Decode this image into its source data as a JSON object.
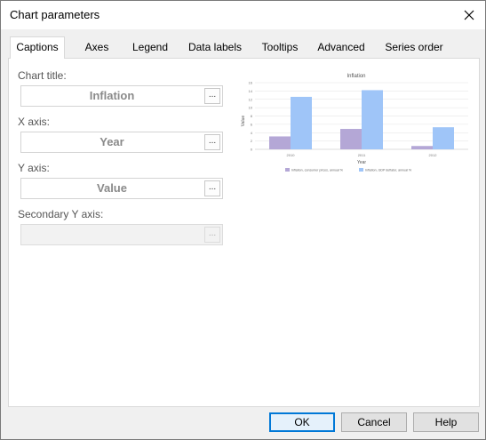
{
  "window": {
    "title": "Chart parameters"
  },
  "tabs": [
    {
      "label": "Captions",
      "active": true
    },
    {
      "label": "Axes"
    },
    {
      "label": "Legend"
    },
    {
      "label": "Data labels"
    },
    {
      "label": "Tooltips"
    },
    {
      "label": "Advanced"
    },
    {
      "label": "Series order"
    }
  ],
  "captions": {
    "chart_title_label": "Chart title:",
    "chart_title_value": "Inflation",
    "x_axis_label": "X axis:",
    "x_axis_value": "Year",
    "y_axis_label": "Y axis:",
    "y_axis_value": "Value",
    "secondary_y_label": "Secondary Y axis:",
    "secondary_y_value": "",
    "ellipsis": "..."
  },
  "footer": {
    "ok": "OK",
    "cancel": "Cancel",
    "help": "Help"
  },
  "chart_data": {
    "type": "bar",
    "title": "Inflation",
    "xlabel": "Year",
    "ylabel": "Value",
    "categories": [
      "2010",
      "2011",
      "2012"
    ],
    "ylim": [
      0,
      16
    ],
    "yticks": [
      "0",
      "2",
      "4",
      "6",
      "8",
      "10",
      "12",
      "14",
      "16"
    ],
    "series": [
      {
        "name": "Inflation, consumer prices, annual %",
        "values": [
          3.1,
          4.9,
          0.8
        ],
        "color": "#b4a7d6"
      },
      {
        "name": "Inflation, GDP deflator, annual %",
        "values": [
          12.6,
          14.2,
          5.3
        ],
        "color": "#9fc5f8"
      }
    ],
    "grid": true,
    "legend": "bottom"
  }
}
